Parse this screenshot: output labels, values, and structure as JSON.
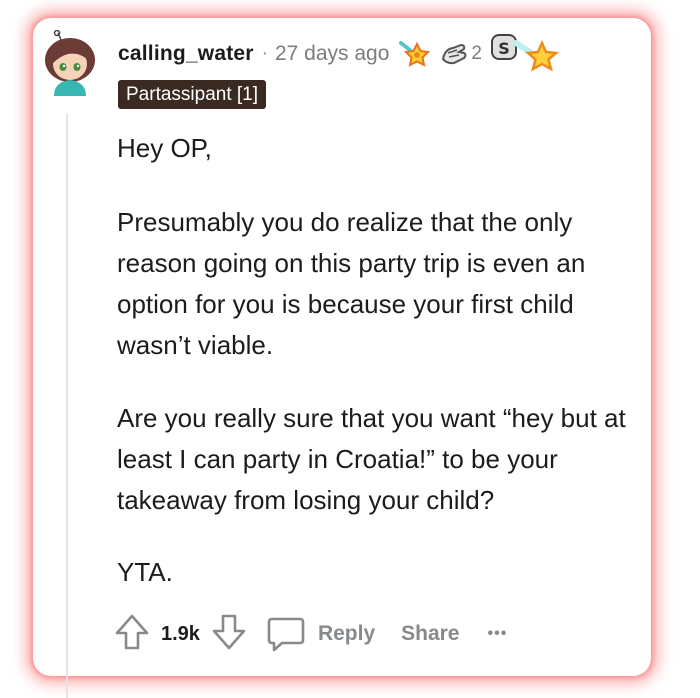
{
  "comment": {
    "username": "calling_water",
    "separator": "·",
    "time": "27 days ago",
    "award_count": "2",
    "flair": "Partassipant [1]",
    "paragraphs": [
      "Hey OP,",
      "Presumably you do realize that the only reason going on this party trip is even an option for you is because your first child wasn’t viable.",
      "Are you really sure that you want “hey but at least I can party in Croatia!” to be your takeaway from losing your child?",
      "YTA."
    ],
    "votes": "1.9k",
    "reply_label": "Reply",
    "share_label": "Share",
    "more_label": "•••"
  },
  "colors": {
    "glow": "#f87878",
    "flair_bg": "#3b2a22",
    "text": "#1c1c1c",
    "muted": "#878a8c"
  },
  "icons": [
    "avatar",
    "rocket-star-award-icon",
    "helping-hand-award-icon",
    "silver-star-award-icon",
    "upvote-icon",
    "downvote-icon",
    "comment-icon",
    "more-icon"
  ]
}
